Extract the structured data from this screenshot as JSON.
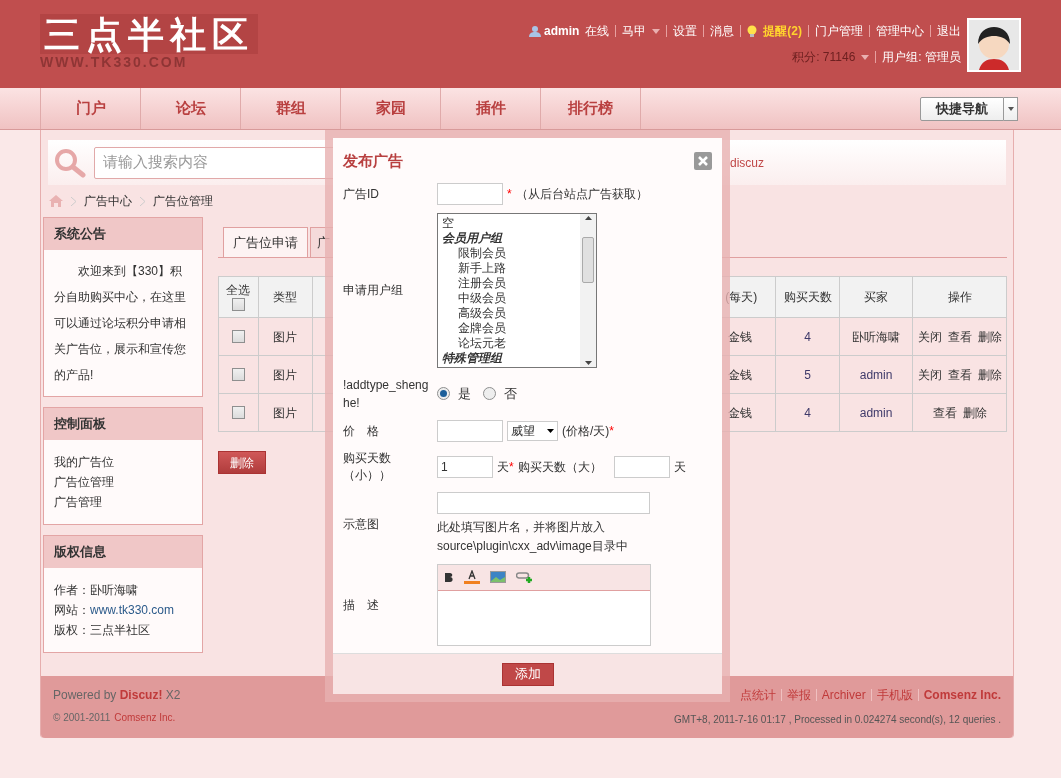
{
  "header": {
    "logo": "三点半社区",
    "logo_url": "WWW.TK330.COM",
    "user": "admin",
    "online": "在线",
    "links": [
      {
        "label": "马甲",
        "kind": "dropdown"
      },
      {
        "label": "设置",
        "kind": "link"
      },
      {
        "label": "消息",
        "kind": "link"
      },
      {
        "label": "提醒(2)",
        "kind": "alert"
      },
      {
        "label": "门户管理",
        "kind": "link"
      },
      {
        "label": "管理中心",
        "kind": "link"
      },
      {
        "label": "退出",
        "kind": "link"
      }
    ],
    "credits": "积分: 71146",
    "usergroup": "用户组: 管理员"
  },
  "nav": {
    "items": [
      "门户",
      "论坛",
      "群组",
      "家园",
      "插件",
      "排行榜"
    ],
    "quick_nav": "快捷导航"
  },
  "search": {
    "placeholder": "请输入搜索内容",
    "hot": "discuz"
  },
  "breadcrumb": [
    "广告中心",
    "广告位管理"
  ],
  "sidebar": [
    {
      "title": "系统公告",
      "kind": "notice",
      "text": "欢迎来到【330】积分自助购买中心，在这里可以通过论坛积分申请相关广告位，展示和宣传您的产品!"
    },
    {
      "title": "控制面板",
      "kind": "links",
      "items": [
        "我的广告位",
        "广告位管理",
        "广告管理"
      ]
    },
    {
      "title": "版权信息",
      "kind": "info",
      "items": [
        {
          "label": "作者：",
          "value": "卧听海啸"
        },
        {
          "label": "网站：",
          "value": "www.tk330.com"
        },
        {
          "label": "版权：",
          "value": "三点半社区"
        }
      ]
    }
  ],
  "tabs": [
    {
      "label": "广告位申请",
      "selected": true
    },
    {
      "label": "广",
      "selected": false
    }
  ],
  "table": {
    "select_all": "全选",
    "select_all_checked": false,
    "columns": [
      "类型",
      "(每天)",
      "购买天数",
      "买家",
      "操作"
    ],
    "rows": [
      {
        "checked": false,
        "type": "图片",
        "price": "金钱",
        "days": "4",
        "buyer": "卧听海啸",
        "actions": [
          "关闭",
          "查看",
          "删除"
        ]
      },
      {
        "checked": false,
        "type": "图片",
        "price": "金钱",
        "days": "5",
        "buyer": "admin",
        "actions": [
          "关闭",
          "查看",
          "删除"
        ]
      },
      {
        "checked": false,
        "type": "图片",
        "price": "金钱",
        "days": "4",
        "buyer": "admin",
        "actions": [
          "查看",
          "删除"
        ]
      }
    ]
  },
  "delete_button": "删除",
  "footer": {
    "powered": "Powered by **Discuz!** X2",
    "copyright": "© 2001-2011",
    "company": "Comsenz Inc.",
    "links": [
      {
        "label": "点统计",
        "bold": false
      },
      {
        "label": "举报",
        "bold": false
      },
      {
        "label": "Archiver",
        "bold": false
      },
      {
        "label": "手机版",
        "bold": false
      },
      {
        "label": "Comsenz Inc.",
        "bold": true
      }
    ],
    "stats": "GMT+8, 2011-7-16 01:17 , Processed in 0.024274 second(s), 12 queries ."
  },
  "dialog": {
    "title": "发布广告",
    "ad_id": {
      "label": "广告ID",
      "required_mark": "*",
      "hint": "（从后台站点广告获取）"
    },
    "user_group": {
      "label": "申请用户组",
      "options": [
        {
          "label": "空",
          "kind": "option"
        },
        {
          "label": "会员用户组",
          "kind": "group",
          "children": [
            {
              "label": "限制会员",
              "kind": "option"
            },
            {
              "label": "新手上路",
              "kind": "option"
            },
            {
              "label": "注册会员",
              "kind": "option"
            },
            {
              "label": "中级会员",
              "kind": "option"
            },
            {
              "label": "高级会员",
              "kind": "option"
            },
            {
              "label": "金牌会员",
              "kind": "option"
            },
            {
              "label": "论坛元老",
              "kind": "option"
            }
          ]
        },
        {
          "label": "特殊管理组",
          "kind": "group"
        }
      ]
    },
    "review": {
      "label": "!addtype_shenghe!",
      "options": [
        {
          "label": "是",
          "selected": true
        },
        {
          "label": "否",
          "selected": false
        }
      ]
    },
    "price": {
      "label": "价　格",
      "currency": "威望",
      "unit": "(价格/天)",
      "required_mark": "*"
    },
    "days": {
      "label": "购买天数（小））",
      "min_value": "1",
      "unit": "天",
      "required_mark": "*",
      "max_label": "购买天数（大）",
      "max_unit": "天"
    },
    "image": {
      "label": "示意图",
      "hint": "此处填写图片名，并将图片放入source\\plugin\\cxx_adv\\image目录中"
    },
    "description": {
      "label": "描　述"
    },
    "submit": "添加"
  }
}
